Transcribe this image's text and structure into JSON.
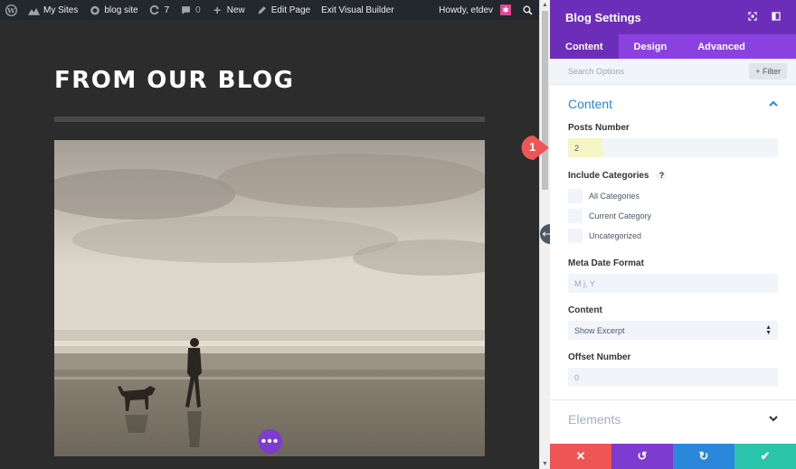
{
  "adminbar": {
    "my_sites": "My Sites",
    "site_name": "blog site",
    "updates_count": "7",
    "comments_count": "0",
    "new_label": "New",
    "edit_page": "Edit Page",
    "exit_builder": "Exit Visual Builder",
    "howdy": "Howdy, etdev"
  },
  "canvas": {
    "blog_title": "FROM OUR BLOG"
  },
  "panel": {
    "title": "Blog Settings",
    "tabs": [
      "Content",
      "Design",
      "Advanced"
    ],
    "search_placeholder": "Search Options",
    "filter_label": "Filter",
    "content_section": "Content",
    "posts_number_label": "Posts Number",
    "posts_number_value": "2",
    "include_categories_label": "Include Categories",
    "help_glyph": "?",
    "categories": [
      "All Categories",
      "Current Category",
      "Uncategorized"
    ],
    "meta_date_label": "Meta Date Format",
    "meta_date_placeholder": "M j, Y",
    "content_label": "Content",
    "content_value": "Show Excerpt",
    "offset_label": "Offset Number",
    "offset_value": "0",
    "elements_section": "Elements"
  },
  "callout_number": "1",
  "colors": {
    "panel_header": "#6c2eb9",
    "tab_bar": "#8b41e0",
    "accent_blue": "#2b87da",
    "cancel": "#ef5555",
    "undo": "#7e3bd0",
    "redo": "#2b87da",
    "save": "#29c4a9",
    "callout": "#ef5555"
  }
}
